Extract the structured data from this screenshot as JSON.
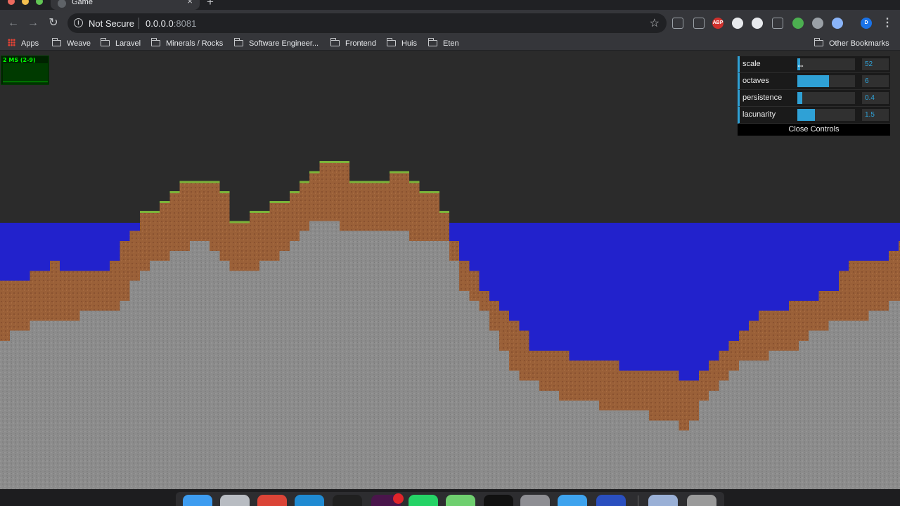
{
  "tab": {
    "title": "Game",
    "close": "×",
    "new_tab": "+"
  },
  "toolbar": {
    "back": "←",
    "forward": "→",
    "reload": "↻",
    "security_label": "Not Secure",
    "url_host": "0.0.0.0",
    "url_port": ":8081",
    "star": "☆",
    "menu": "⋮",
    "extensions": [
      {
        "name": "camera-ext-icon",
        "color": "#35363a",
        "text": ""
      },
      {
        "name": "pen-ext-icon",
        "color": "#35363a",
        "text": ""
      },
      {
        "name": "adblock-ext-icon",
        "color": "#d0312d",
        "text": "ABP"
      },
      {
        "name": "compass-ext-icon",
        "color": "#e8eaed",
        "text": ""
      },
      {
        "name": "vault-ext-icon",
        "color": "#e8eaed",
        "text": ""
      },
      {
        "name": "move-ext-icon",
        "color": "#35363a",
        "text": ""
      },
      {
        "name": "chrome-ext-icon",
        "color": "#4caf50",
        "text": ""
      },
      {
        "name": "record-ext-icon",
        "color": "#9aa0a6",
        "text": ""
      },
      {
        "name": "target-ext-icon",
        "color": "#8ab4f8",
        "text": ""
      },
      {
        "name": "profile-avatar-icon",
        "color": "#1a73e8",
        "text": "D"
      }
    ]
  },
  "bookmarks": {
    "apps": "Apps",
    "items": [
      "Weave",
      "Laravel",
      "Minerals / Rocks",
      "Software Engineer...",
      "Frontend",
      "Huis",
      "Eten"
    ],
    "other": "Other Bookmarks"
  },
  "stats": {
    "text": "2 MS (2-9)"
  },
  "gui": {
    "controls": [
      {
        "label": "scale",
        "value": "52",
        "fraction": 0.03
      },
      {
        "label": "octaves",
        "value": "6",
        "fraction": 0.55
      },
      {
        "label": "persistence",
        "value": "0.4",
        "fraction": 0.08
      },
      {
        "label": "lacunarity",
        "value": "1.5",
        "fraction": 0.3
      }
    ],
    "close_label": "Close Controls"
  },
  "colors": {
    "sky": "#2b2b2b",
    "water": "#2222cc",
    "dirt": "#9a6038",
    "stone": "#8c8c8c",
    "grass": "#7bb33a",
    "accent": "#2fa1d6"
  },
  "dock": [
    {
      "name": "finder-dock-icon",
      "color": "#3d9cf0"
    },
    {
      "name": "safari-dock-icon",
      "color": "#b8bcc2"
    },
    {
      "name": "chrome-dock-icon",
      "color": "#db4437"
    },
    {
      "name": "vscode-dock-icon",
      "color": "#1f8ad2"
    },
    {
      "name": "terminal-dock-icon",
      "color": "#202020"
    },
    {
      "name": "slack-dock-icon",
      "color": "#4a154b"
    },
    {
      "name": "whatsapp-dock-icon",
      "color": "#25d366"
    },
    {
      "name": "sourcetree-dock-icon",
      "color": "#6fcf6f"
    },
    {
      "name": "activity-monitor-dock-icon",
      "color": "#111111"
    },
    {
      "name": "system-preferences-dock-icon",
      "color": "#8e8e93"
    },
    {
      "name": "xcode-dock-icon",
      "color": "#3ea3ee"
    },
    {
      "name": "screen-dock-icon",
      "color": "#2a4fbf"
    },
    {
      "name": "documents-dock-icon",
      "color": "#9ab0d6"
    },
    {
      "name": "trash-dock-icon",
      "color": "#9a9a9a"
    }
  ]
}
